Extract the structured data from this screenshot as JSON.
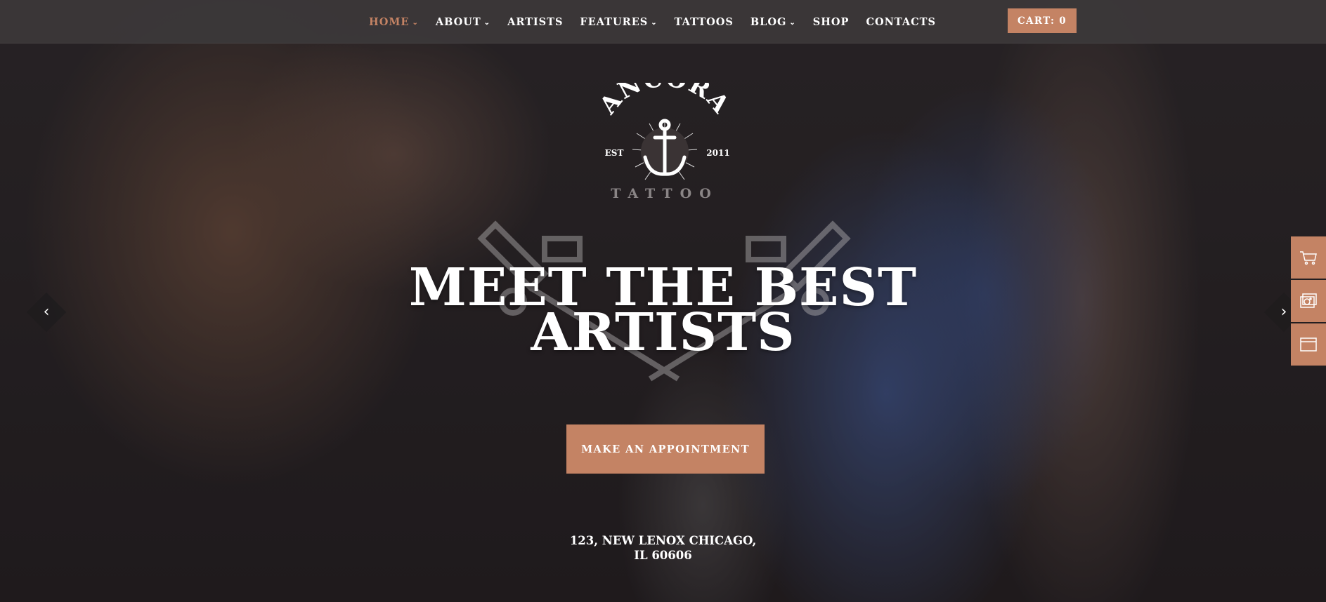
{
  "nav": {
    "items": [
      {
        "label": "HOME",
        "has_dropdown": true,
        "active": true
      },
      {
        "label": "ABOUT",
        "has_dropdown": true,
        "active": false
      },
      {
        "label": "ARTISTS",
        "has_dropdown": false,
        "active": false
      },
      {
        "label": "FEATURES",
        "has_dropdown": true,
        "active": false
      },
      {
        "label": "TATTOOS",
        "has_dropdown": false,
        "active": false
      },
      {
        "label": "BLOG",
        "has_dropdown": true,
        "active": false
      },
      {
        "label": "SHOP",
        "has_dropdown": false,
        "active": false
      },
      {
        "label": "CONTACTS",
        "has_dropdown": false,
        "active": false
      }
    ],
    "cart_label": "CART: 0"
  },
  "logo": {
    "name": "ANCORA",
    "est": "EST",
    "year": "2011",
    "tagline": "TATTOO"
  },
  "hero": {
    "headline_line1": "MEET THE BEST",
    "headline_line2": "ARTISTS",
    "cta_label": "MAKE AN APPOINTMENT",
    "address_line1": "123, NEW LENOX CHICAGO,",
    "address_line2": "IL 60606"
  },
  "slider": {
    "prev_icon": "chevron-left-icon",
    "next_icon": "chevron-right-icon"
  },
  "side_panel": {
    "icons": [
      "cart-icon",
      "gallery-icon",
      "browser-window-icon"
    ]
  },
  "colors": {
    "accent": "#c48364",
    "navbar": "#3c3839",
    "text": "#ffffff"
  }
}
